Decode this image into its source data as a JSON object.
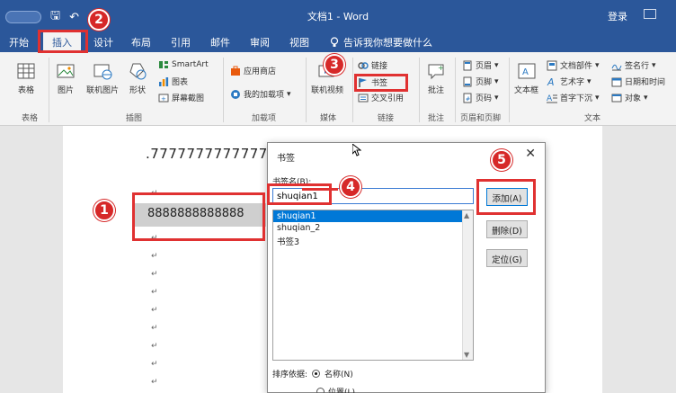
{
  "titlebar": {
    "title": "文档1 - Word",
    "login": "登录",
    "save_glyph": "🖫",
    "undo_glyph": "↶",
    "dropdown_glyph": "▾"
  },
  "menu": {
    "tabs": [
      "开始",
      "插入",
      "设计",
      "布局",
      "引用",
      "邮件",
      "审阅",
      "视图"
    ],
    "tell_me": "告诉我你想要做什么"
  },
  "ribbon": {
    "table": "表格",
    "picture": "图片",
    "online_picture": "联机图片",
    "shapes": "形状",
    "smartart": "SmartArt",
    "chart": "图表",
    "screenshot": "屏幕截图",
    "store": "应用商店",
    "my_addins": "我的加载项",
    "online_video": "联机视频",
    "link": "链接",
    "bookmark": "书签",
    "cross_ref": "交叉引用",
    "comment": "批注",
    "header": "页眉",
    "footer": "页脚",
    "page_number": "页码",
    "textbox": "文本框",
    "quick_parts": "文档部件",
    "wordart": "艺术字",
    "dropcap": "首字下沉",
    "signature": "签名行",
    "datetime": "日期和时间",
    "object": "对象",
    "groups": {
      "tables": "表格",
      "illustrations": "插图",
      "addins": "加载项",
      "media": "媒体",
      "links": "链接",
      "comments": "批注",
      "header_footer": "页眉和页脚",
      "text": "文本"
    }
  },
  "document": {
    "line1": ".7777777777777",
    "line2": "8888888888888",
    "para_mark": "↵"
  },
  "dialog": {
    "title": "书签",
    "name_label": "书签名(B):",
    "input_value": "shuqian1",
    "list": [
      "shuqian1",
      "shuqian_2",
      "书签3"
    ],
    "add": "添加(A)",
    "delete": "删除(D)",
    "goto": "定位(G)",
    "sort_label": "排序依据:",
    "sort_name": "名称(N)",
    "sort_location": "位置(L)",
    "close": "✕"
  },
  "callouts": [
    "1",
    "2",
    "3",
    "4",
    "5"
  ],
  "colors": {
    "accent": "#2b579a",
    "highlight": "#e03131",
    "badge": "#d62828",
    "selection": "#0078d7"
  }
}
